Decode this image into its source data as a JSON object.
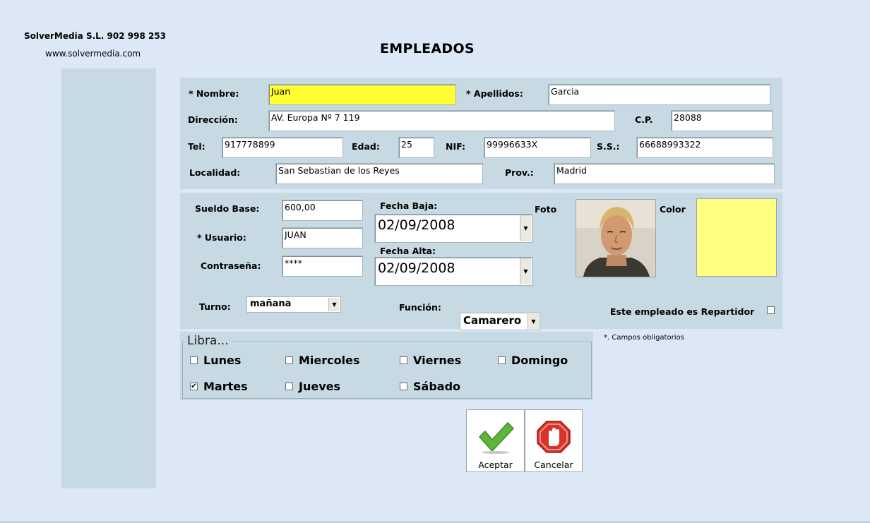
{
  "header": {
    "company": "SolverMedia S.L. 902 998 253",
    "website": "www.solvermedia.com",
    "title": "EMPLEADOS"
  },
  "form": {
    "nombre_label": "* Nombre:",
    "nombre_value": "Juan",
    "apellidos_label": "* Apellidos:",
    "apellidos_value": "Garcia",
    "direccion_label": "Dirección:",
    "direccion_value": "AV. Europa Nº 7 119",
    "cp_label": "C.P.",
    "cp_value": "28088",
    "tel_label": "Tel:",
    "tel_value": "917778899",
    "edad_label": "Edad:",
    "edad_value": "25",
    "nif_label": "NIF:",
    "nif_value": "99996633X",
    "ss_label": "S.S.:",
    "ss_value": "66688993322",
    "localidad_label": "Localidad:",
    "localidad_value": "San Sebastian de los Reyes",
    "prov_label": "Prov.:",
    "prov_value": "Madrid"
  },
  "work": {
    "sueldo_label": "Sueldo Base:",
    "sueldo_value": "600,00",
    "usuario_label": "* Usuario:",
    "usuario_value": "JUAN",
    "contrasena_label": "Contraseña:",
    "contrasena_value": "****",
    "fecha_baja_label": "Fecha Baja:",
    "fecha_baja_value": "02/09/2008",
    "fecha_alta_label": "Fecha Alta:",
    "fecha_alta_value": "02/09/2008",
    "foto_label": "Foto",
    "color_label": "Color",
    "color_value": "#ffff80",
    "turno_label": "Turno:",
    "turno_value": "mañana",
    "funcion_label": "Función:",
    "funcion_value": "Camarero",
    "repartidor_label": "Este empleado es Repartidor",
    "repartidor_checked": false,
    "required_note": "*. Campos obligatorios"
  },
  "libra": {
    "legend": "Libra...",
    "days": [
      {
        "label": "Lunes",
        "checked": false
      },
      {
        "label": "Miercoles",
        "checked": false
      },
      {
        "label": "Viernes",
        "checked": false
      },
      {
        "label": "Domingo",
        "checked": false
      },
      {
        "label": "Martes",
        "checked": true
      },
      {
        "label": "Jueves",
        "checked": false
      },
      {
        "label": "Sábado",
        "checked": false
      }
    ]
  },
  "buttons": {
    "accept_label": "Aceptar",
    "cancel_label": "Cancelar"
  },
  "icons": {
    "dropdown": "chevron-down-icon",
    "accept": "checkmark-icon",
    "cancel": "stop-hand-icon",
    "checked_mark": "✔"
  }
}
